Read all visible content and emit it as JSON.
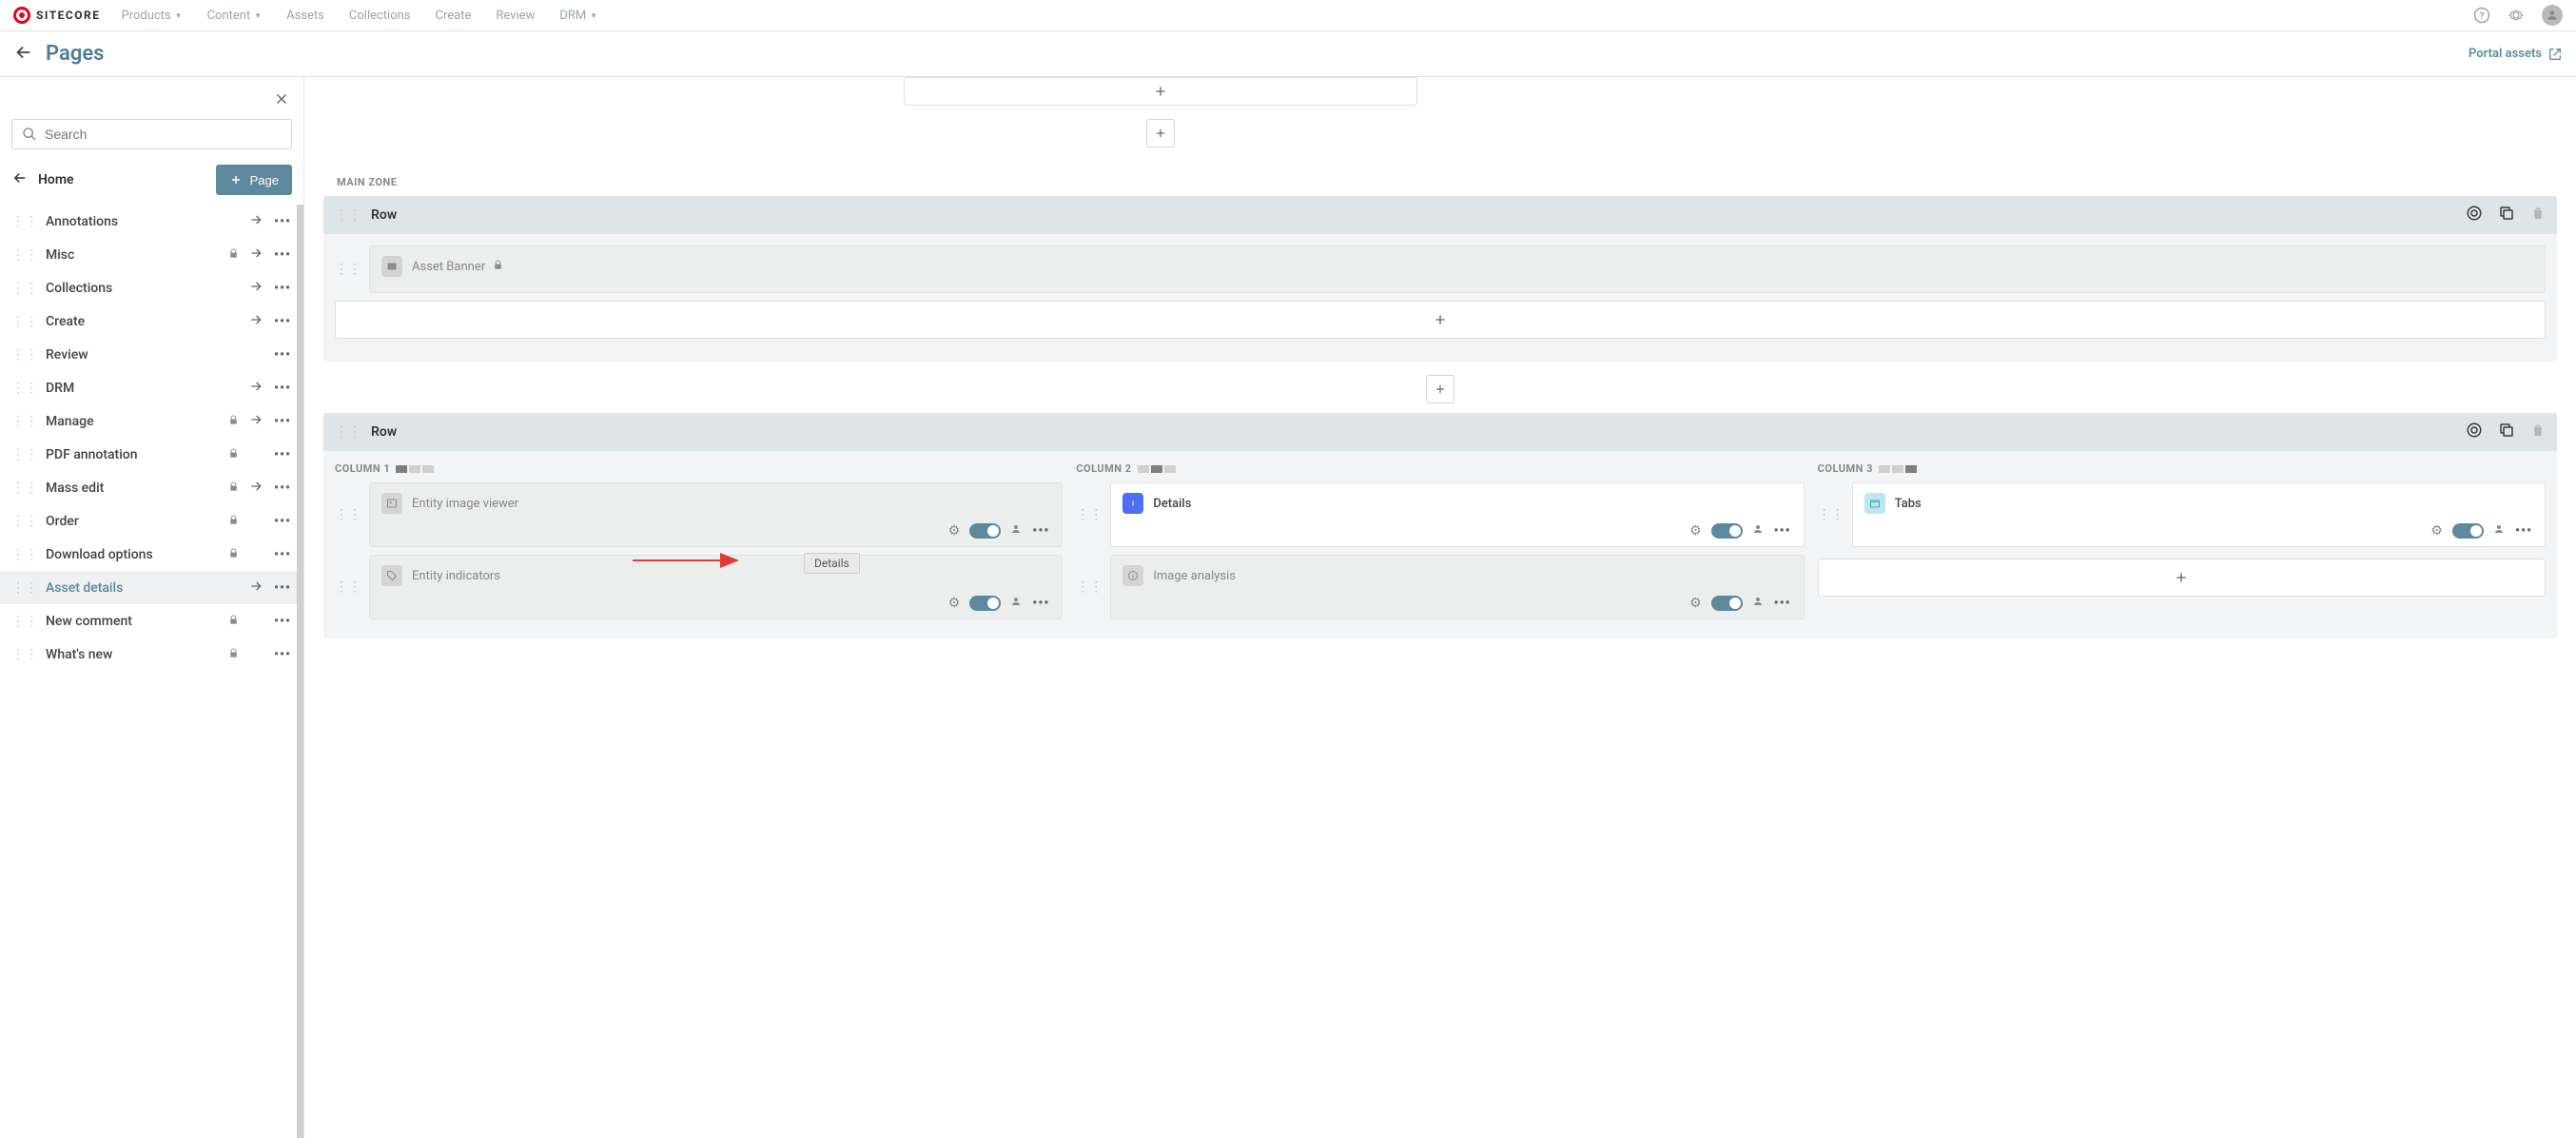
{
  "brand": "SITECORE",
  "nav": [
    "Products",
    "Content",
    "Assets",
    "Collections",
    "Create",
    "Review",
    "DRM"
  ],
  "nav_dropdown": [
    true,
    true,
    false,
    false,
    false,
    false,
    true
  ],
  "page_title": "Pages",
  "portal_link": "Portal assets",
  "search_placeholder": "Search",
  "home_label": "Home",
  "page_button": "Page",
  "tree": [
    {
      "label": "Annotations",
      "lock": false,
      "arrow": true
    },
    {
      "label": "Misc",
      "lock": true,
      "arrow": true
    },
    {
      "label": "Collections",
      "lock": false,
      "arrow": true
    },
    {
      "label": "Create",
      "lock": false,
      "arrow": true
    },
    {
      "label": "Review",
      "lock": false,
      "arrow": false
    },
    {
      "label": "DRM",
      "lock": false,
      "arrow": true
    },
    {
      "label": "Manage",
      "lock": true,
      "arrow": true
    },
    {
      "label": "PDF annotation",
      "lock": true,
      "arrow": false
    },
    {
      "label": "Mass edit",
      "lock": true,
      "arrow": true
    },
    {
      "label": "Order",
      "lock": true,
      "arrow": false
    },
    {
      "label": "Download options",
      "lock": true,
      "arrow": false
    },
    {
      "label": "Asset details",
      "lock": false,
      "arrow": true,
      "active": true
    },
    {
      "label": "New comment",
      "lock": true,
      "arrow": false
    },
    {
      "label": "What's new",
      "lock": true,
      "arrow": false
    }
  ],
  "zone_label": "MAIN ZONE",
  "row_label": "Row",
  "col_labels": [
    "COLUMN 1",
    "COLUMN 2",
    "COLUMN 3"
  ],
  "components": {
    "asset_banner": "Asset Banner",
    "entity_image_viewer": "Entity image viewer",
    "entity_indicators": "Entity indicators",
    "details": "Details",
    "image_analysis": "Image analysis",
    "tabs": "Tabs"
  },
  "tooltip_text": "Details"
}
